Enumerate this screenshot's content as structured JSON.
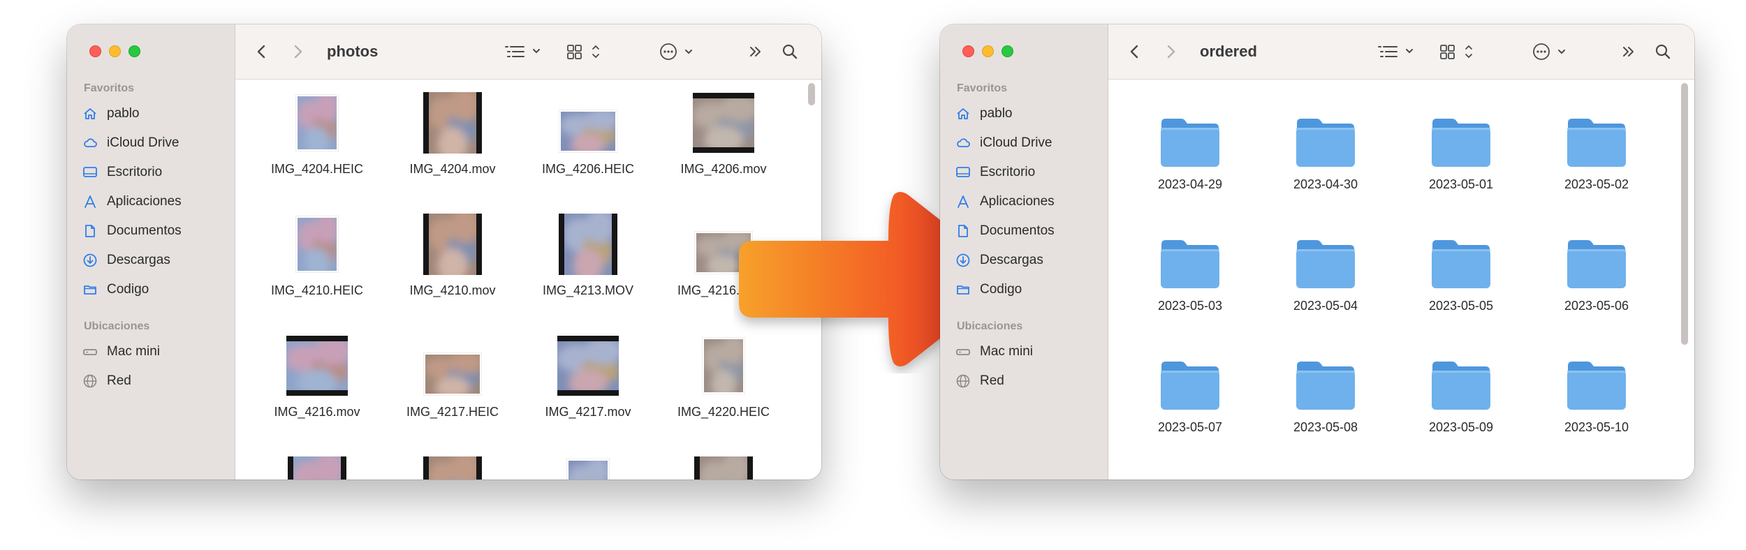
{
  "windows": [
    {
      "id": "photos",
      "title": "photos",
      "sidebar": {
        "favorites_title": "Favoritos",
        "favorites": [
          {
            "label": "pablo",
            "icon": "home-icon"
          },
          {
            "label": "iCloud Drive",
            "icon": "cloud-icon"
          },
          {
            "label": "Escritorio",
            "icon": "desktop-icon"
          },
          {
            "label": "Aplicaciones",
            "icon": "applications-icon"
          },
          {
            "label": "Documentos",
            "icon": "document-icon"
          },
          {
            "label": "Descargas",
            "icon": "download-icon"
          },
          {
            "label": "Codigo",
            "icon": "folder-icon"
          }
        ],
        "locations_title": "Ubicaciones",
        "locations": [
          {
            "label": "Mac mini",
            "icon": "mac-mini-icon"
          },
          {
            "label": "Red",
            "icon": "network-icon"
          }
        ]
      },
      "items": [
        {
          "name": "IMG_4204.HEIC",
          "kind": "portrait-photo"
        },
        {
          "name": "IMG_4204.mov",
          "kind": "video-portrait"
        },
        {
          "name": "IMG_4206.HEIC",
          "kind": "landscape-photo"
        },
        {
          "name": "IMG_4206.mov",
          "kind": "video-landscape"
        },
        {
          "name": "IMG_4210.HEIC",
          "kind": "portrait-photo"
        },
        {
          "name": "IMG_4210.mov",
          "kind": "video-portrait"
        },
        {
          "name": "IMG_4213.MOV",
          "kind": "video-portrait"
        },
        {
          "name": "IMG_4216.HEIC",
          "kind": "landscape-photo"
        },
        {
          "name": "IMG_4216.mov",
          "kind": "video-landscape"
        },
        {
          "name": "IMG_4217.HEIC",
          "kind": "landscape-photo"
        },
        {
          "name": "IMG_4217.mov",
          "kind": "video-landscape"
        },
        {
          "name": "IMG_4220.HEIC",
          "kind": "portrait-photo"
        },
        {
          "name": "",
          "kind": "video-portrait"
        },
        {
          "name": "",
          "kind": "video-portrait"
        },
        {
          "name": "",
          "kind": "portrait-photo"
        },
        {
          "name": "",
          "kind": "video-portrait"
        }
      ]
    },
    {
      "id": "ordered",
      "title": "ordered",
      "sidebar": {
        "favorites_title": "Favoritos",
        "favorites": [
          {
            "label": "pablo",
            "icon": "home-icon"
          },
          {
            "label": "iCloud Drive",
            "icon": "cloud-icon"
          },
          {
            "label": "Escritorio",
            "icon": "desktop-icon"
          },
          {
            "label": "Aplicaciones",
            "icon": "applications-icon"
          },
          {
            "label": "Documentos",
            "icon": "document-icon"
          },
          {
            "label": "Descargas",
            "icon": "download-icon"
          },
          {
            "label": "Codigo",
            "icon": "folder-icon"
          }
        ],
        "locations_title": "Ubicaciones",
        "locations": [
          {
            "label": "Mac mini",
            "icon": "mac-mini-icon"
          },
          {
            "label": "Red",
            "icon": "network-icon"
          }
        ]
      },
      "items": [
        {
          "name": "2023-04-29",
          "kind": "folder"
        },
        {
          "name": "2023-04-30",
          "kind": "folder"
        },
        {
          "name": "2023-05-01",
          "kind": "folder"
        },
        {
          "name": "2023-05-02",
          "kind": "folder"
        },
        {
          "name": "2023-05-03",
          "kind": "folder"
        },
        {
          "name": "2023-05-04",
          "kind": "folder"
        },
        {
          "name": "2023-05-05",
          "kind": "folder"
        },
        {
          "name": "2023-05-06",
          "kind": "folder"
        },
        {
          "name": "2023-05-07",
          "kind": "folder"
        },
        {
          "name": "2023-05-08",
          "kind": "folder"
        },
        {
          "name": "2023-05-09",
          "kind": "folder"
        },
        {
          "name": "2023-05-10",
          "kind": "folder"
        },
        {
          "name": "",
          "kind": "folder"
        },
        {
          "name": "",
          "kind": "folder"
        },
        {
          "name": "",
          "kind": "folder"
        },
        {
          "name": "",
          "kind": "folder"
        }
      ]
    }
  ],
  "arrow": {
    "icon": "arrow-right-icon",
    "gradient_start": "#f7a12a",
    "gradient_end": "#ef2c23"
  },
  "colors": {
    "folder": "#6fb1ec",
    "folder_tab": "#4f97dd",
    "sidebar_accent": "#2f7ee8"
  }
}
